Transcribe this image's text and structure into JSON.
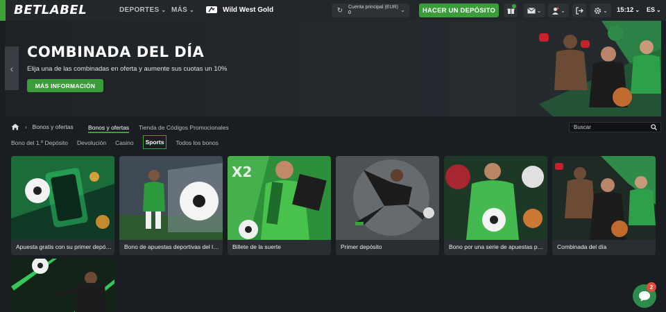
{
  "header": {
    "logo_part1": "BET",
    "logo_part2": "LABEL",
    "nav_sports": "DEPORTES",
    "nav_more": "MÁS",
    "featured_game": "Wild West Gold",
    "balance_label": "Cuenta principal (EUR)",
    "balance_amount": "0",
    "deposit_button": "HACER UN DEPÓSITO",
    "time": "15:12",
    "language": "ES",
    "brand_color": "#3ca33a"
  },
  "banner": {
    "title": "COMBINADA DEL DÍA",
    "subtitle": "Elija una de las combinadas en oferta y aumente sus cuotas un 10%",
    "button": "MÁS INFORMACIÓN"
  },
  "breadcrumb": {
    "current": "Bonos y ofertas"
  },
  "tabs": {
    "bonuses": "Bonos y ofertas",
    "promo_store": "Tienda de Códigos Promocionales"
  },
  "search": {
    "placeholder": "Buscar"
  },
  "filters": [
    "Bono del 1.º Depósito",
    "Devolución",
    "Casino",
    "Sports",
    "Todos los bonos"
  ],
  "active_filter": "Sports",
  "cards": [
    {
      "title": "Apuesta gratis con su primer depósito"
    },
    {
      "title": "Bono de apuestas deportivas del lunes"
    },
    {
      "title": "Billete de la suerte"
    },
    {
      "title": "Primer depósito"
    },
    {
      "title": "Bono por una serie de apuestas perdidas"
    },
    {
      "title": "Combinada del día"
    },
    {
      "title": ""
    }
  ],
  "chat": {
    "unread": "2"
  }
}
